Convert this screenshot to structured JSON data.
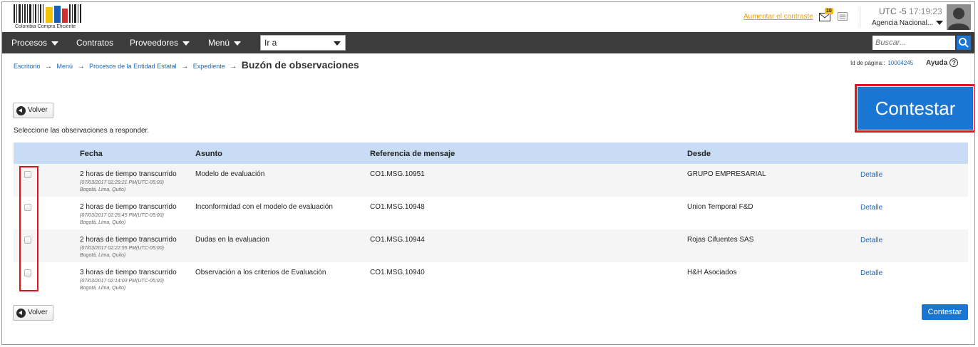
{
  "header": {
    "logo_text": "Colombia Compra Eficiente",
    "contrast_link": "Aumentar el contraste",
    "mail_badge": "10",
    "utc_zone": "UTC -5",
    "utc_time": "17:19:23",
    "agency": "Agencia Nacional...",
    "icons": [
      "mail-icon",
      "document-icon",
      "user-avatar-icon"
    ]
  },
  "nav": {
    "items": [
      "Procesos",
      "Contratos",
      "Proveedores",
      "Menú"
    ],
    "goto_value": "Ir a",
    "search_placeholder": "Buscar...",
    "search_icon": "search-icon"
  },
  "breadcrumb": {
    "items": [
      "Escritorio",
      "Menú",
      "Procesos de la Entidad Estatal",
      "Expediente"
    ],
    "separator": "→",
    "current": "Buzón de observaciones"
  },
  "page_id": {
    "label": "Id de página::",
    "value": "10004245"
  },
  "help": {
    "label": "Ayuda",
    "icon": "?"
  },
  "actions": {
    "back_label": "Volver",
    "reply_big_label": "Contestar",
    "reply_small_label": "Contestar"
  },
  "instruction": "Seleccione las observaciones a responder.",
  "table": {
    "headers": [
      "Fecha",
      "Asunto",
      "Referencia de mensaje",
      "Desde"
    ],
    "rows": [
      {
        "elapsed": "2 horas de tiempo transcurrido",
        "timestamp": "(07/03/2017 02:29:21 PM(UTC-05:00) Bogotá, Lima, Quito)",
        "subject": "Modelo de evaluación",
        "reference": "CO1.MSG.10951",
        "from": "GRUPO EMPRESARIAL",
        "action": "Detalle"
      },
      {
        "elapsed": "2 horas de tiempo transcurrido",
        "timestamp": "(07/03/2017 02:26:45 PM(UTC-05:00) Bogotá, Lima, Quito)",
        "subject": "Inconformidad con el modelo de evaluación",
        "reference": "CO1.MSG.10948",
        "from": "Union Temporal F&D",
        "action": "Detalle"
      },
      {
        "elapsed": "2 horas de tiempo transcurrido",
        "timestamp": "(07/03/2017 02:22:55 PM(UTC-05:00) Bogotá, Lima, Quito)",
        "subject": "Dudas en la evaluacion",
        "reference": "CO1.MSG.10944",
        "from": "Rojas Cifuentes SAS",
        "action": "Detalle"
      },
      {
        "elapsed": "3 horas de tiempo transcurrido",
        "timestamp": "(07/03/2017 02:14:03 PM(UTC-05:00) Bogotá, Lima, Quito)",
        "subject": "Observación a los criterios de Evaluación",
        "reference": "CO1.MSG.10940",
        "from": "H&H Asociados",
        "action": "Detalle"
      }
    ]
  },
  "colors": {
    "accent": "#1a76d2",
    "nav_bg": "#3c3c3c",
    "table_header_bg": "#c8dcf5",
    "highlight": "#e1131d",
    "contrast_link": "#f0a000"
  }
}
